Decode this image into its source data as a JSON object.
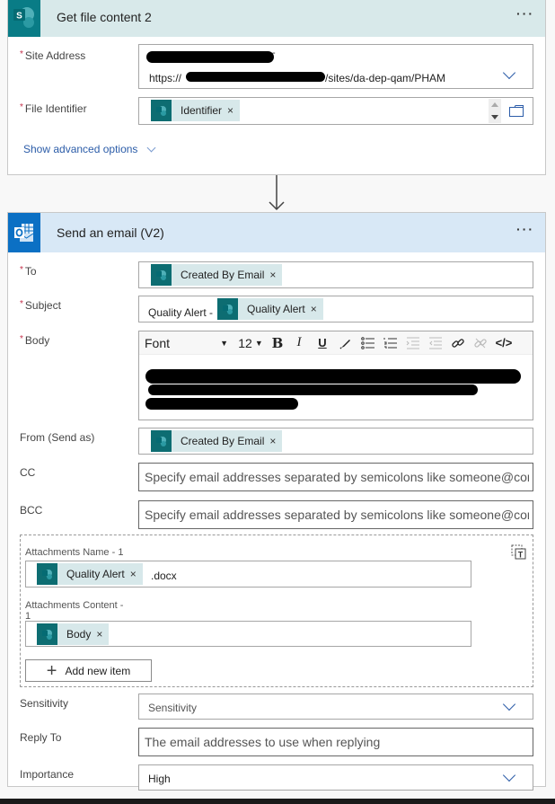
{
  "get_file_content": {
    "title": "Get file content 2",
    "menu": "···",
    "site_address": {
      "label": "Site Address",
      "required": "*",
      "dash": "-",
      "url_prefix": "https://",
      "url_suffix": "/sites/da-dep-qam/PHAM"
    },
    "file_identifier": {
      "label": "File Identifier",
      "required": "*",
      "token": "Identifier",
      "token_remove": "×"
    },
    "advanced_options": "Show advanced options"
  },
  "send_email": {
    "title": "Send an email (V2)",
    "menu": "···",
    "to": {
      "label": "To",
      "required": "*",
      "token": "Created By Email",
      "token_remove": "×"
    },
    "subject": {
      "label": "Subject",
      "required": "*",
      "prefix_text": "Quality Alert -",
      "token": "Quality Alert",
      "token_remove": "×"
    },
    "body": {
      "label": "Body",
      "required": "*",
      "toolbar": {
        "font": "Font",
        "font_size": "12",
        "bold": "B",
        "italic": "I",
        "underline": "U",
        "code": "</>"
      }
    },
    "from": {
      "label": "From (Send as)",
      "token": "Created By Email",
      "token_remove": "×"
    },
    "cc": {
      "label": "CC",
      "placeholder": "Specify email addresses separated by semicolons like someone@con"
    },
    "bcc": {
      "label": "BCC",
      "placeholder": "Specify email addresses separated by semicolons like someone@con"
    },
    "attachments": {
      "name_label": "Attachments Name - 1",
      "name_token": "Quality Alert",
      "name_token_remove": "×",
      "name_suffix": ".docx",
      "content_label_line1": "Attachments Content -",
      "content_label_line2": "1",
      "content_token": "Body",
      "content_token_remove": "×",
      "add_item": "Add new item"
    },
    "sensitivity": {
      "label": "Sensitivity",
      "value": "Sensitivity"
    },
    "reply_to": {
      "label": "Reply To",
      "placeholder": "The email addresses to use when replying"
    },
    "importance": {
      "label": "Importance",
      "value": "High"
    }
  },
  "colors": {
    "sharepoint_teal": "#097c86",
    "outlook_blue": "#0b70c4",
    "link_blue": "#2b5ca8",
    "required_red": "#c4314b"
  }
}
